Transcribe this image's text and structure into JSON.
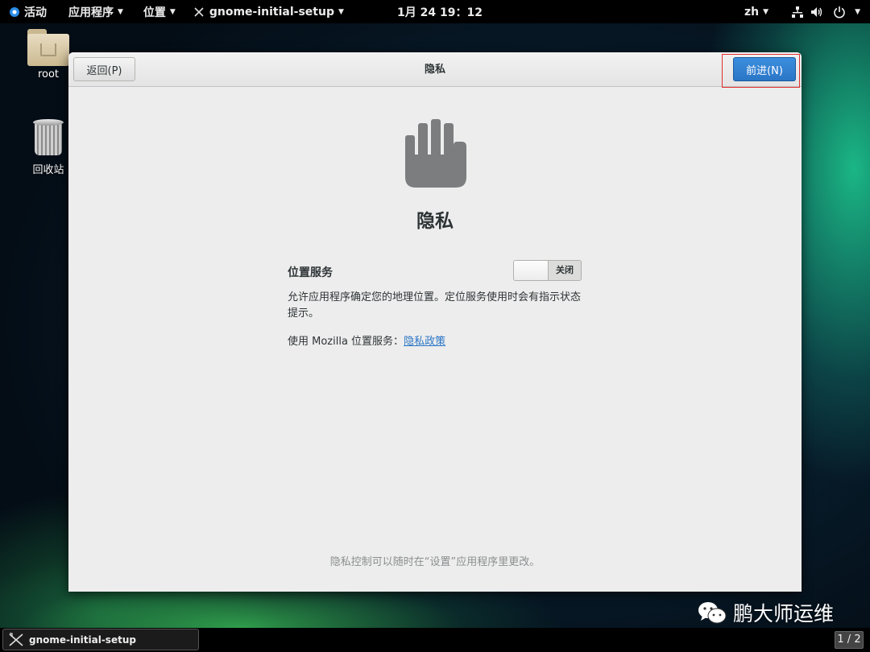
{
  "topbar": {
    "activities": "活动",
    "applications": "应用程序",
    "places": "位置",
    "window_title": "gnome-initial-setup",
    "clock": "1月 24 19：12",
    "input_method": "zh"
  },
  "desktop": {
    "icons": [
      {
        "label": "root",
        "icon": "home-folder-icon"
      },
      {
        "label": "回收站",
        "icon": "trash-icon"
      }
    ]
  },
  "dialog": {
    "back_label": "返回(P)",
    "title": "隐私",
    "next_label": "前进(N)",
    "heading": "隐私",
    "location_label": "位置服务",
    "location_switch_state": "关闭",
    "location_desc": "允许应用程序确定您的地理位置。定位服务使用时会有指示状态提示。",
    "mozilla_prefix": "使用 Mozilla 位置服务：",
    "policy_link": "隐私政策",
    "footer_note": "隐私控制可以随时在“设置”应用程序里更改。"
  },
  "taskbar": {
    "task_label": "gnome-initial-setup",
    "workspace": "1 / 2"
  },
  "watermark": "鹏大师运维",
  "colors": {
    "accent": "#2a76c6",
    "highlight_border": "#e03030"
  }
}
